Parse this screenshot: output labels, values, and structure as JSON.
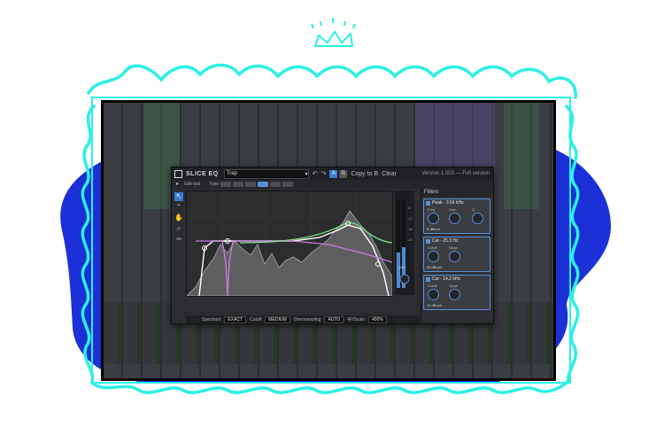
{
  "plugin": {
    "logo": "SLICE EQ",
    "preset": "Trap",
    "undo": "↶",
    "redo": "↷",
    "ab_a": "A",
    "ab_b": "B",
    "copy_to": "Copy to B",
    "clear": "Clear",
    "version": "Version 1.003 — Full version",
    "edit_tool": "Edit tool",
    "type_label": "Type",
    "gain_label": "Gain",
    "db_scale": [
      "-6",
      "-12",
      "-18",
      "-24"
    ],
    "freq_labels": [
      "50 Hz",
      "100",
      "200",
      "500",
      "1 kHz",
      "2 k",
      "5 k",
      "10 k"
    ]
  },
  "filters": {
    "title": "Filters",
    "cards": [
      {
        "title": "Peak - 3.59 kHz",
        "l1": "Freq",
        "l2": "Gain",
        "l3": "Q",
        "value": "6  dB/oct"
      },
      {
        "title": "Cut - 25.3 Hz",
        "l1": "Cutoff",
        "l2": "Slope",
        "l3": "",
        "value": "96  dB/oct"
      },
      {
        "title": "Cut - 14.2 kHz",
        "l1": "Cutoff",
        "l2": "Slope",
        "l3": "",
        "value": "12  dB/oct"
      }
    ]
  },
  "bottombar": {
    "spectrum_label": "Spectrum",
    "spectrum_value": "EXACT",
    "cutoff_label": "Cutoff",
    "cutoff_value": "MEDIUM",
    "oversampling_label": "Oversampling",
    "oversampling_value": "AUTO",
    "view_label": "4F/Scale",
    "view_value": "400%"
  },
  "colors": {
    "accent": "#5b8fd8",
    "cyan_frame": "#2cf0e6",
    "blob": "#1b30d6"
  }
}
